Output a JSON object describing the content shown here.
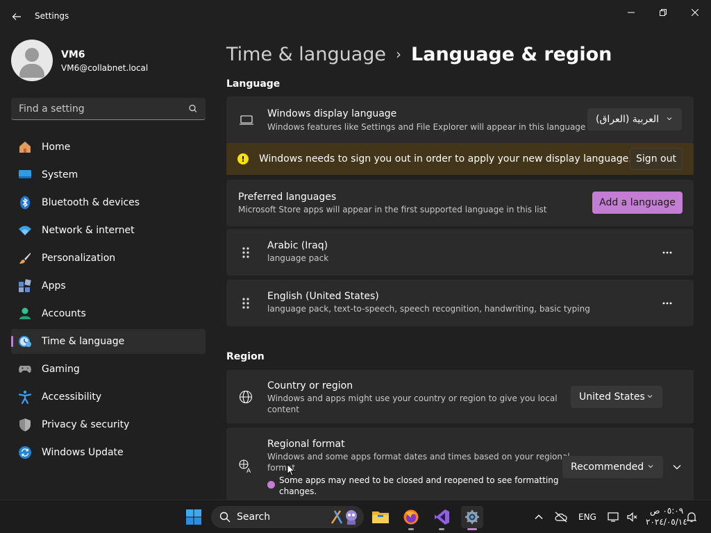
{
  "app": {
    "title": "Settings",
    "back_label": "←"
  },
  "window_controls": {
    "minimize": "—",
    "maximize": "□",
    "close": "✕"
  },
  "user": {
    "name": "VM6",
    "email": "VM6@collabnet.local"
  },
  "search": {
    "placeholder": "Find a setting"
  },
  "sidebar": {
    "items": [
      {
        "label": "Home",
        "icon": "home-icon"
      },
      {
        "label": "System",
        "icon": "system-icon"
      },
      {
        "label": "Bluetooth & devices",
        "icon": "bluetooth-icon"
      },
      {
        "label": "Network & internet",
        "icon": "network-icon"
      },
      {
        "label": "Personalization",
        "icon": "brush-icon"
      },
      {
        "label": "Apps",
        "icon": "apps-icon"
      },
      {
        "label": "Accounts",
        "icon": "accounts-icon"
      },
      {
        "label": "Time & language",
        "icon": "time-language-icon",
        "active": true
      },
      {
        "label": "Gaming",
        "icon": "gamepad-icon"
      },
      {
        "label": "Accessibility",
        "icon": "accessibility-icon"
      },
      {
        "label": "Privacy & security",
        "icon": "shield-icon"
      },
      {
        "label": "Windows Update",
        "icon": "update-icon"
      }
    ]
  },
  "breadcrumb": {
    "parent": "Time & language",
    "separator": "›",
    "current": "Language & region"
  },
  "language_section": {
    "title": "Language",
    "display_language": {
      "title": "Windows display language",
      "subtitle": "Windows features like Settings and File Explorer will appear in this language",
      "value": "العربية (العراق)"
    },
    "warning": {
      "text": "Windows needs to sign you out in order to apply your new display language.",
      "button": "Sign out",
      "icon_glyph": "!"
    },
    "preferred": {
      "title": "Preferred languages",
      "subtitle": "Microsoft Store apps will appear in the first supported language in this list",
      "button": "Add a language"
    },
    "languages": [
      {
        "name": "Arabic (Iraq)",
        "features": "language pack"
      },
      {
        "name": "English (United States)",
        "features": "language pack, text-to-speech, speech recognition, handwriting, basic typing"
      }
    ],
    "more_glyph": "···"
  },
  "region_section": {
    "title": "Region",
    "country": {
      "title": "Country or region",
      "subtitle_line1": "Windows and apps might use your country or region to give you local",
      "subtitle_line2": "content",
      "value": "United States"
    },
    "format": {
      "title": "Regional format",
      "subtitle_line1": "Windows and some apps format dates and times based on your regional",
      "subtitle_line2": "format",
      "note_line1": "Some apps may need to be closed and reopened to see formatting",
      "note_line2": "changes.",
      "value": "Recommended"
    }
  },
  "taskbar": {
    "search_label": "Search",
    "language": "ENG",
    "time": "٠٥:٠٩ ص",
    "date": "٢٠٢٤/٠٥/١٤"
  },
  "colors": {
    "accent": "#c37ed4",
    "warning_bg": "#433519",
    "warning_icon": "#fce100"
  }
}
